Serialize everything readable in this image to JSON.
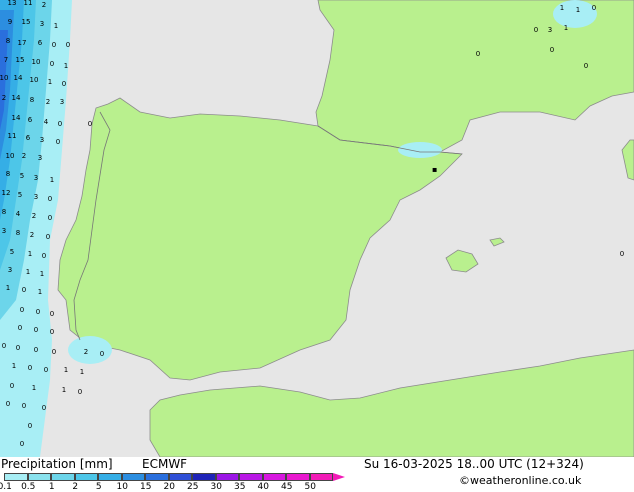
{
  "legend": {
    "title": "Precipitation [mm]",
    "model": "ECMWF",
    "valid_time": "Su 16-03-2025 18..00 UTC (12+324)",
    "credit": "©weatheronline.co.uk",
    "ticks": [
      "0.1",
      "0.5",
      "1",
      "2",
      "5",
      "10",
      "15",
      "20",
      "25",
      "30",
      "35",
      "40",
      "45",
      "50"
    ],
    "colors": [
      "#a8eef5",
      "#8ae2ee",
      "#6cd5ea",
      "#4dc6e8",
      "#35aee6",
      "#2c8ee0",
      "#2a6fdd",
      "#2f4fd6",
      "#1f24b8",
      "#9b16e6",
      "#b917e6",
      "#d718e0",
      "#e918cf",
      "#f21bb7"
    ]
  },
  "map": {
    "colors": {
      "sea": "#e6e6e6",
      "land": "#b9f08e",
      "coast": "#8c8c8c",
      "border": "#777777"
    },
    "labels": [
      {
        "t": "13",
        "c": "w"
      },
      {
        "t": "11",
        "c": "w"
      },
      {
        "t": "2",
        "c": "w"
      },
      {
        "t": "9",
        "c": "w"
      },
      {
        "t": "15",
        "c": "w"
      },
      {
        "t": "3",
        "c": "w"
      },
      {
        "t": "1",
        "c": "w"
      },
      {
        "t": "8",
        "c": "w"
      },
      {
        "t": "17",
        "c": "w"
      },
      {
        "t": "6",
        "c": "w"
      },
      {
        "t": "0",
        "c": "w"
      },
      {
        "t": "0",
        "c": "w"
      },
      {
        "t": "7",
        "c": "w"
      },
      {
        "t": "15",
        "c": "w"
      },
      {
        "t": "10",
        "c": "w"
      },
      {
        "t": "0",
        "c": "w"
      },
      {
        "t": "1",
        "c": "w"
      },
      {
        "t": "10",
        "c": "w"
      },
      {
        "t": "14",
        "c": "w"
      },
      {
        "t": "10",
        "c": "w"
      },
      {
        "t": "1",
        "c": "w"
      },
      {
        "t": "0",
        "c": "w"
      },
      {
        "t": "2",
        "c": "w"
      },
      {
        "t": "14",
        "c": "w"
      },
      {
        "t": "8",
        "c": "w"
      },
      {
        "t": "2",
        "c": "w"
      },
      {
        "t": "3",
        "c": "w"
      },
      {
        "t": "14",
        "c": "w"
      },
      {
        "t": "6",
        "c": "w"
      },
      {
        "t": "4",
        "c": "w"
      },
      {
        "t": "0",
        "c": "w"
      },
      {
        "t": "11",
        "c": "w"
      },
      {
        "t": "6",
        "c": "w"
      },
      {
        "t": "3",
        "c": "w"
      },
      {
        "t": "0",
        "c": "w"
      },
      {
        "t": "10",
        "c": "w"
      },
      {
        "t": "2",
        "c": "w"
      },
      {
        "t": "3",
        "c": "w"
      },
      {
        "t": "8",
        "c": "w"
      },
      {
        "t": "5",
        "c": "w"
      },
      {
        "t": "3",
        "c": "w"
      },
      {
        "t": "1",
        "c": "w"
      },
      {
        "t": "12",
        "c": "w"
      },
      {
        "t": "5",
        "c": "w"
      },
      {
        "t": "3",
        "c": "w"
      },
      {
        "t": "0",
        "c": "w"
      },
      {
        "t": "8",
        "c": "w"
      },
      {
        "t": "4",
        "c": "w"
      },
      {
        "t": "2",
        "c": "w"
      },
      {
        "t": "0",
        "c": "w"
      },
      {
        "t": "3",
        "c": "w"
      },
      {
        "t": "8",
        "c": "w"
      },
      {
        "t": "2",
        "c": "w"
      },
      {
        "t": "0",
        "c": "w"
      },
      {
        "t": "5",
        "c": "w"
      },
      {
        "t": "1",
        "c": "w"
      },
      {
        "t": "0",
        "c": "w"
      },
      {
        "t": "3",
        "c": "w"
      },
      {
        "t": "1",
        "c": "w"
      },
      {
        "t": "1",
        "c": "w"
      },
      {
        "t": "1",
        "c": "w"
      },
      {
        "t": "0",
        "c": "w"
      },
      {
        "t": "1",
        "c": "w"
      },
      {
        "t": "0",
        "c": "w"
      },
      {
        "t": "0",
        "c": "w"
      },
      {
        "t": "0",
        "c": "w"
      },
      {
        "t": "0",
        "c": "w"
      },
      {
        "t": "0",
        "c": "w"
      },
      {
        "t": "0",
        "c": "w"
      },
      {
        "t": "0",
        "c": "w"
      },
      {
        "t": "0",
        "c": "w"
      },
      {
        "t": "0",
        "c": "w"
      },
      {
        "t": "0",
        "c": "w"
      },
      {
        "t": "2",
        "c": "w"
      },
      {
        "t": "0",
        "c": "w"
      },
      {
        "t": "1",
        "c": "w"
      },
      {
        "t": "0",
        "c": "w"
      },
      {
        "t": "0",
        "c": "w"
      },
      {
        "t": "1",
        "c": "w"
      },
      {
        "t": "1",
        "c": "w"
      },
      {
        "t": "0",
        "c": "w"
      },
      {
        "t": "1",
        "c": "w"
      },
      {
        "t": "1",
        "c": "w"
      },
      {
        "t": "0",
        "c": "w"
      },
      {
        "t": "0",
        "c": "w"
      },
      {
        "t": "0",
        "c": "w"
      },
      {
        "t": "0",
        "c": "w"
      },
      {
        "t": "0",
        "c": "w"
      },
      {
        "t": "0",
        "c": "w"
      },
      {
        "t": "1",
        "c": "e"
      },
      {
        "t": "1",
        "c": "e"
      },
      {
        "t": "0",
        "c": "e"
      },
      {
        "t": "0",
        "c": "e"
      },
      {
        "t": "3",
        "c": "e"
      },
      {
        "t": "1",
        "c": "e"
      },
      {
        "t": "0",
        "c": "e"
      },
      {
        "t": "0",
        "c": "e"
      },
      {
        "t": "0",
        "c": "e"
      },
      {
        "t": "0",
        "c": "m"
      },
      {
        "t": "0",
        "c": "m"
      }
    ]
  }
}
